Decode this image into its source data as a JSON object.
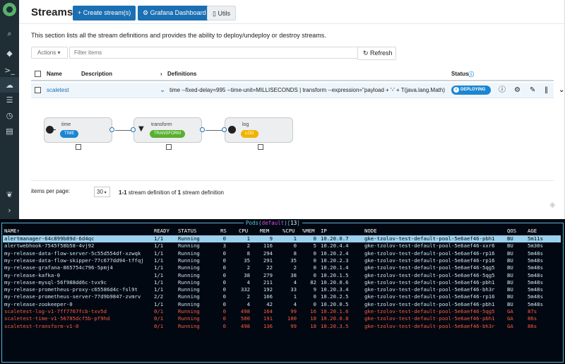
{
  "page": {
    "title": "Streams",
    "create_button": "Create stream(s)",
    "grafana_button": "Grafana Dashboard",
    "utils_button": "Utils",
    "intro": "This section lists all the stream definitions and provides the ability to deploy/undeploy or destroy streams.",
    "actions_label": "Actions",
    "filter_placeholder": "Filter items",
    "refresh_label": "Refresh"
  },
  "table": {
    "columns": {
      "name": "Name",
      "description": "Description",
      "definitions": "Definitions",
      "status": "Status"
    },
    "row": {
      "name": "scaletest",
      "definition": "time --fixed-delay=995 --time-unit=MILLISECONDS | transform --expression=\"payload + '-' + T(java.lang.Math).exp(700)\" | log",
      "status": "DEPLOYING"
    }
  },
  "graph": {
    "nodes": [
      {
        "label": "time",
        "badge": "TIME",
        "color": "#1b86d1"
      },
      {
        "label": "transform",
        "badge": "TRANSFORM",
        "color": "#58b030"
      },
      {
        "label": "log",
        "badge": "LOG",
        "color": "#f0b400"
      }
    ]
  },
  "pager": {
    "label": "items per page:",
    "per_page": "30",
    "range": "1-1",
    "text1": " stream definition of ",
    "total": "1",
    "text2": " stream definition"
  },
  "terminal": {
    "title_prefix": "Pods(",
    "namespace": "default",
    "title_mid": ")[",
    "count": "13",
    "title_suffix": "]",
    "headers": [
      "NAME↑",
      "READY",
      "STATUS",
      "RS",
      "CPU",
      "MEM",
      "%CPU",
      "%MEM",
      "IP",
      "NODE",
      "QOS",
      "AGE"
    ],
    "rows": [
      [
        "alertmanager-64c899b89d-6d4qc",
        "1/1",
        "Running",
        "0",
        "1",
        "9",
        "1",
        "0",
        "10.20.0.7",
        "gke-tzolov-test-default-pool-5e6aef46-pbh1",
        "BU",
        "5m11s"
      ],
      [
        "alertwebhook-7545f58b58-4vj92",
        "1/1",
        "Running",
        "3",
        "2",
        "116",
        "0",
        "5",
        "10.20.4.4",
        "gke-tzolov-test-default-pool-5e6aef46-xxr6",
        "BU",
        "5m30s"
      ],
      [
        "my-release-data-flow-server-5c55d554df-xzwqk",
        "1/1",
        "Running",
        "0",
        "8",
        "294",
        "8",
        "0",
        "10.20.2.4",
        "gke-tzolov-test-default-pool-5e6aef46-rp16",
        "BU",
        "5m48s"
      ],
      [
        "my-release-data-flow-skipper-77c677dd94-tffqj",
        "1/1",
        "Running",
        "0",
        "35",
        "291",
        "35",
        "0",
        "10.20.2.3",
        "gke-tzolov-test-default-pool-5e6aef46-rp16",
        "BU",
        "5m48s"
      ],
      [
        "my-release-grafana-865754c796-5pmj4",
        "1/1",
        "Running",
        "0",
        "2",
        "22",
        "2",
        "0",
        "10.20.1.4",
        "gke-tzolov-test-default-pool-5e6aef46-5qg5",
        "BU",
        "5m48s"
      ],
      [
        "my-release-kafka-0",
        "1/1",
        "Running",
        "0",
        "38",
        "279",
        "38",
        "0",
        "10.20.1.5",
        "gke-tzolov-test-default-pool-5e6aef46-5qg5",
        "BU",
        "5m48s"
      ],
      [
        "my-release-mysql-56f988dd6c-tvx9c",
        "1/1",
        "Running",
        "0",
        "4",
        "211",
        "4",
        "82",
        "10.20.0.6",
        "gke-tzolov-test-default-pool-5e6aef46-pbh1",
        "BU",
        "5m48s"
      ],
      [
        "my-release-prometheus-proxy-c65586d4c-fsl9t",
        "1/1",
        "Running",
        "0",
        "332",
        "192",
        "33",
        "9",
        "10.20.3.4",
        "gke-tzolov-test-default-pool-5e6aef46-bh3r",
        "BU",
        "5m48s"
      ],
      [
        "my-release-prometheus-server-77d9b9847-zvmrv",
        "2/2",
        "Running",
        "0",
        "2",
        "166",
        "1",
        "0",
        "10.20.2.5",
        "gke-tzolov-test-default-pool-5e6aef46-rp16",
        "BU",
        "5m48s"
      ],
      [
        "my-release-zookeeper-0",
        "1/1",
        "Running",
        "0",
        "4",
        "42",
        "4",
        "0",
        "10.20.0.5",
        "gke-tzolov-test-default-pool-5e6aef46-pbh1",
        "BU",
        "5m48s"
      ],
      [
        "scaletest-log-v1-7ff7767fcb-txv5d",
        "0/1",
        "Running",
        "0",
        "498",
        "164",
        "99",
        "16",
        "10.20.1.6",
        "gke-tzolov-test-default-pool-5e6aef46-5qg5",
        "GA",
        "87s"
      ],
      [
        "scaletest-time-v1-56785dcf5b-pf9hd",
        "0/1",
        "Running",
        "0",
        "500",
        "191",
        "100",
        "18",
        "10.20.0.8",
        "gke-tzolov-test-default-pool-5e6aef46-pbh1",
        "GA",
        "86s"
      ],
      [
        "scaletest-transform-v1-0",
        "0/1",
        "Running",
        "0",
        "498",
        "136",
        "99",
        "18",
        "10.20.3.5",
        "gke-tzolov-test-default-pool-5e6aef46-bh3r",
        "GA",
        "86s"
      ]
    ]
  }
}
